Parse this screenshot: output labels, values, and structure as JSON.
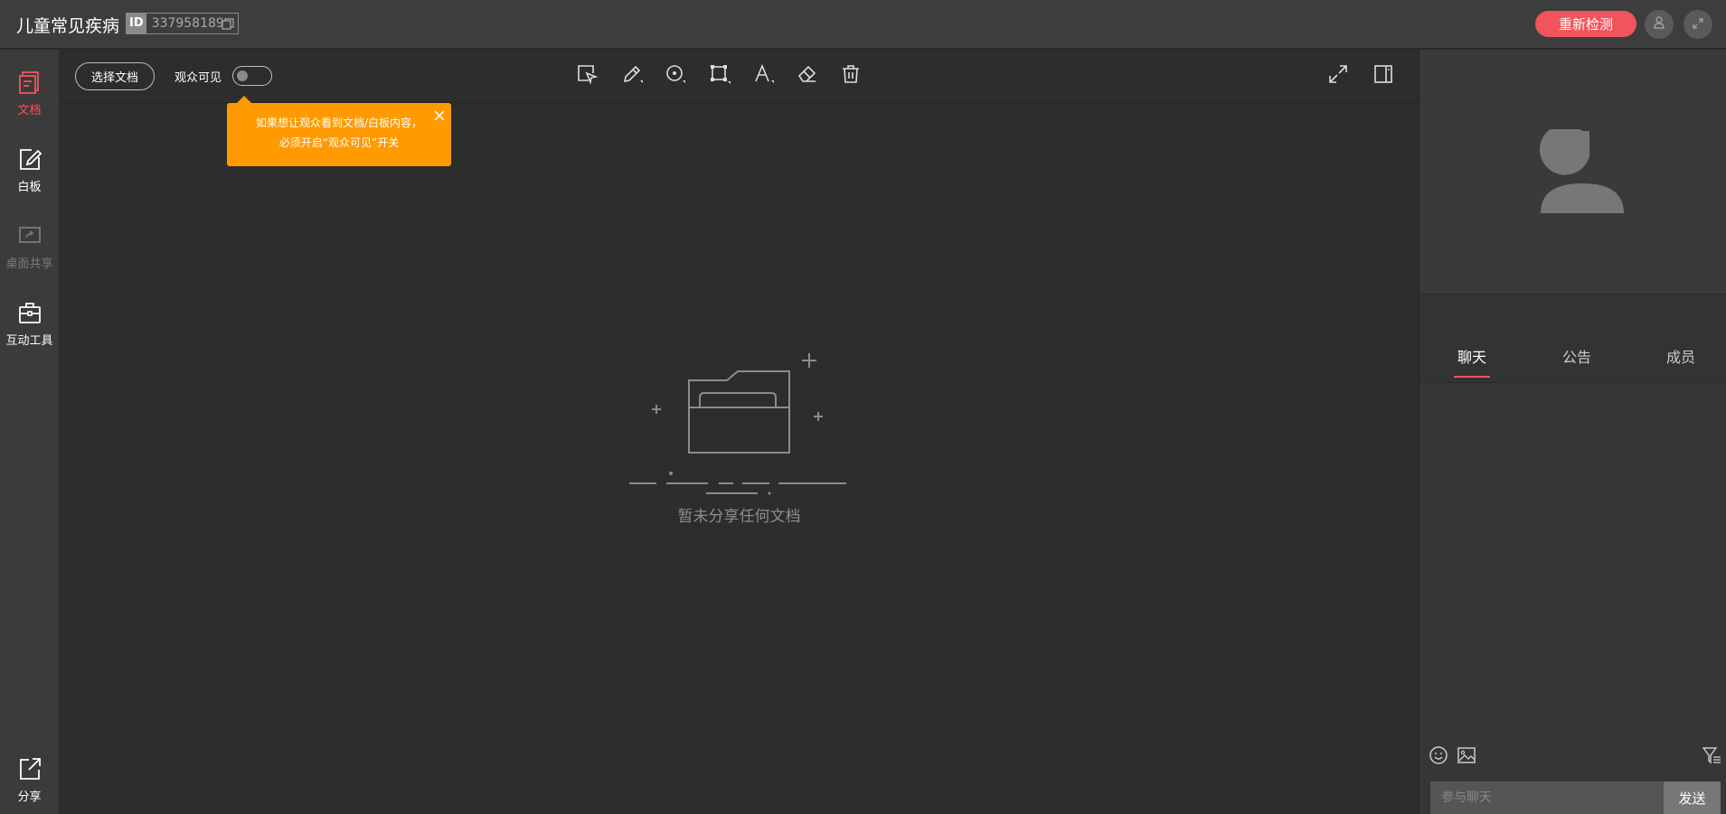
{
  "header": {
    "title": "儿童常见疾病",
    "id_tag": "ID",
    "room_id": "337958189",
    "recheck_label": "重新检测"
  },
  "leftnav": {
    "items": [
      {
        "label": "文档",
        "icon": "document-icon"
      },
      {
        "label": "白板",
        "icon": "whiteboard-icon"
      },
      {
        "label": "桌面共享",
        "icon": "screen-share-icon"
      },
      {
        "label": "互动工具",
        "icon": "toolbox-icon"
      }
    ],
    "share_label": "分享"
  },
  "toolbar": {
    "select_doc_label": "选择文档",
    "audience_visible_label": "观众可见"
  },
  "tooltip": {
    "line1": "如果想让观众看到文档/白板内容，",
    "line2": "必须开启“观众可见”开关"
  },
  "empty_state": {
    "text": "暂未分享任何文档"
  },
  "right_panel": {
    "tabs": [
      "聊天",
      "公告",
      "成员"
    ],
    "chat_placeholder": "参与聊天",
    "send_label": "发送"
  },
  "colors": {
    "accent": "#f2545b",
    "tooltip": "#ff9a00"
  }
}
